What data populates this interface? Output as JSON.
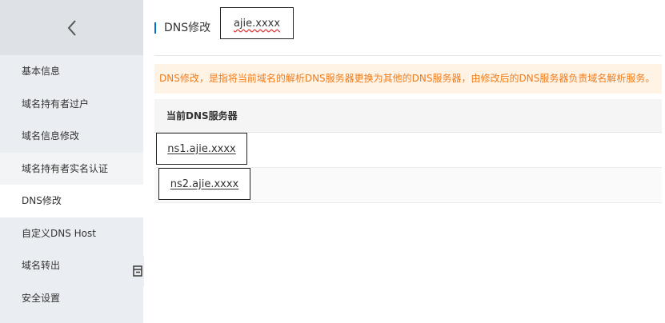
{
  "sidebar": {
    "items": [
      {
        "label": "基本信息"
      },
      {
        "label": "域名持有者过户"
      },
      {
        "label": "域名信息修改"
      },
      {
        "label": "域名持有者实名认证"
      },
      {
        "label": "DNS修改"
      },
      {
        "label": "自定义DNS Host"
      },
      {
        "label": "域名转出"
      },
      {
        "label": "安全设置"
      }
    ],
    "active_item": "DNS修改"
  },
  "header": {
    "title": "DNS修改",
    "domain": "ajie.xxxx"
  },
  "notice": {
    "text": "DNS修改，是指将当前域名的解析DNS服务器更换为其他的DNS服务器，由修改后的DNS服务器负责域名解析服务。"
  },
  "dns_table": {
    "header": "当前DNS服务器",
    "rows": [
      {
        "server": "ns1.ajie.xxxx"
      },
      {
        "server": "ns2.ajie.xxxx"
      }
    ]
  },
  "colors": {
    "sidebar_bg": "#eaedf1",
    "accent": "#0070cc",
    "notice_bg": "#fff3e5",
    "notice_text": "#f27c1b"
  },
  "icons": {
    "back": "chevron-left-icon",
    "collapse": "sidebar-collapse-icon"
  }
}
